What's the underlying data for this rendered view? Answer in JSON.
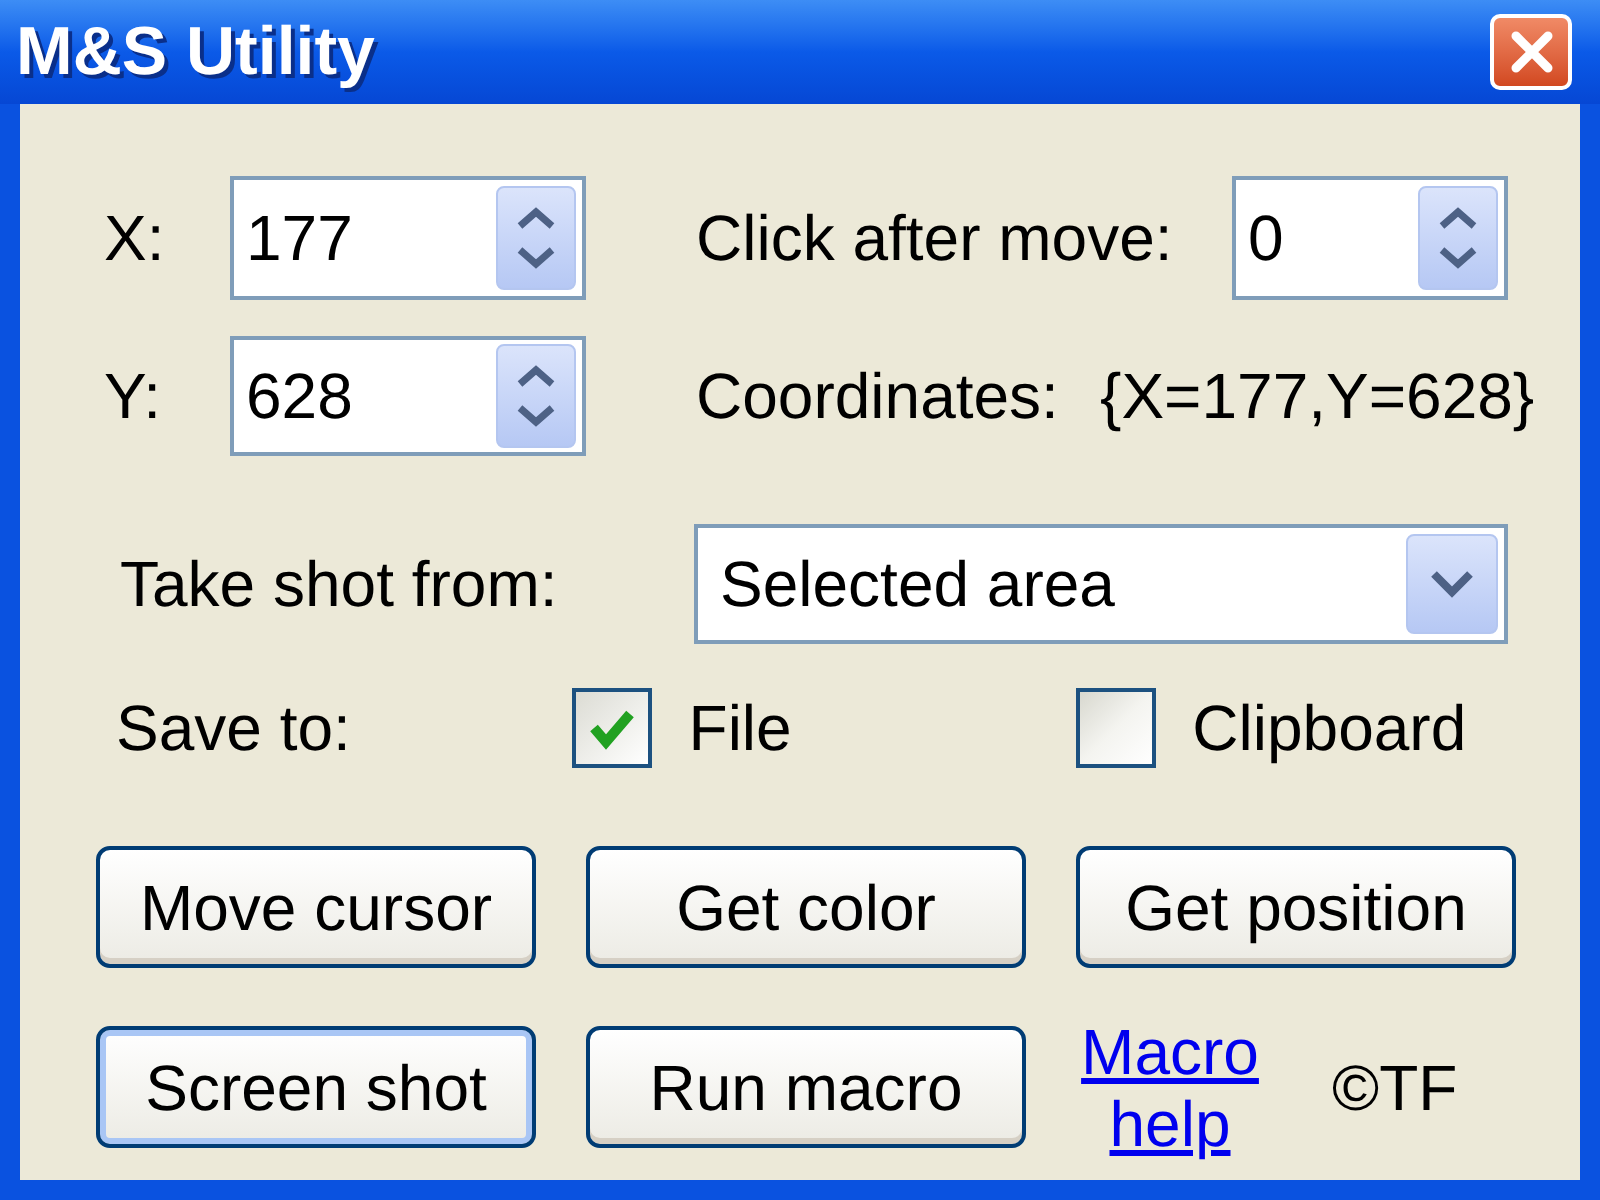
{
  "window": {
    "title": "M&S Utility"
  },
  "position_fields": [
    {
      "label": "X:",
      "value": "177"
    },
    {
      "label": "Y:",
      "value": "628"
    }
  ],
  "click_after_move": {
    "label": "Click after move:",
    "value": "0"
  },
  "coordinates": {
    "label": "Coordinates:",
    "value": "{X=177,Y=628}"
  },
  "take_shot_from": {
    "label": "Take shot from:",
    "value": "Selected area"
  },
  "save_to": {
    "label": "Save to:",
    "options": [
      {
        "label": "File",
        "checked": true
      },
      {
        "label": "Clipboard",
        "checked": false
      }
    ]
  },
  "buttons": [
    {
      "label": "Move cursor",
      "default": false
    },
    {
      "label": "Get color",
      "default": false
    },
    {
      "label": "Get position",
      "default": false
    },
    {
      "label": "Screen shot",
      "default": true
    },
    {
      "label": "Run macro",
      "default": false
    }
  ],
  "link": "Macro help",
  "copyright": "©TF"
}
